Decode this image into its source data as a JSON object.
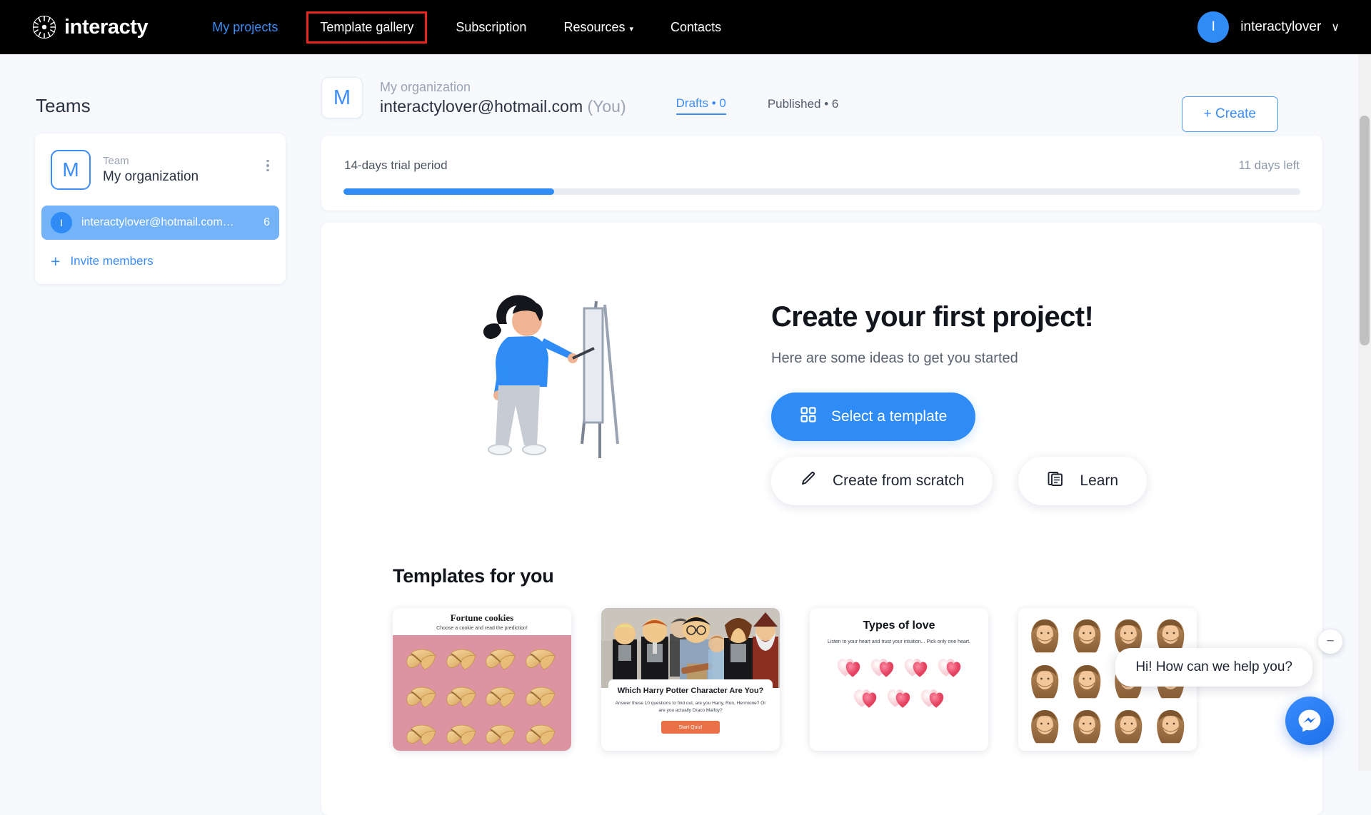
{
  "topnav": {
    "brand": "interacty",
    "brand_icon": "interacty-starburst-logo",
    "items": [
      {
        "label": "My projects",
        "state": "link"
      },
      {
        "label": "Template gallery",
        "state": "highlighted"
      },
      {
        "label": "Subscription",
        "state": "default"
      },
      {
        "label": "Resources",
        "state": "dropdown",
        "caret": "▾"
      },
      {
        "label": "Contacts",
        "state": "default"
      }
    ],
    "user": {
      "initial": "I",
      "name": "interactylover",
      "caret": "∨"
    },
    "highlight_color": "#e8251f",
    "link_color": "#3b8cf5"
  },
  "sidebar": {
    "title": "Teams",
    "team": {
      "badge": "M",
      "label": "Team",
      "name": "My organization",
      "menu_icon": "kebab-menu-icon"
    },
    "member": {
      "initial": "I",
      "email": "interactylover@hotmail.com…",
      "count": "6"
    },
    "invite": {
      "plus": "+",
      "label": "Invite members"
    }
  },
  "org_header": {
    "badge": "M",
    "subtitle": "My organization",
    "email": "interactylover@hotmail.com",
    "you": "(You)",
    "tabs": [
      {
        "label": "Drafts • 0",
        "active": true
      },
      {
        "label": "Published • 6",
        "active": false
      }
    ],
    "create_label": "+ Create"
  },
  "trial": {
    "label": "14-days trial period",
    "remaining": "11 days left",
    "percent": 22
  },
  "hero": {
    "title": "Create your first project!",
    "subtitle": "Here are some ideas to get you started",
    "primary_button": {
      "label": "Select a template",
      "icon": "grid-squares-icon"
    },
    "secondary_buttons": [
      {
        "label": "Create from scratch",
        "icon": "pencil-icon"
      },
      {
        "label": "Learn",
        "icon": "documents-icon"
      }
    ],
    "illustration": "woman-painting-at-easel-illustration"
  },
  "templates": {
    "heading": "Templates for you",
    "cards": [
      {
        "name": "fortune-cookies",
        "title": "Fortune cookies",
        "subtitle": "Choose a cookie and read the prediction!",
        "bg": "#dd94a2",
        "item_count": 12
      },
      {
        "name": "harry-potter-quiz",
        "title": "Which Harry Potter Character Are You?",
        "subtitle": "Answer these 10 questions to find out, are you Harry, Ron, Hermione? Or are you actually Draco Malfoy?",
        "button": "Start Quiz!",
        "button_color": "#ea7048"
      },
      {
        "name": "types-of-love",
        "title": "Types of love",
        "subtitle": "Listen to your heart and trust your intuition... Pick only one heart.",
        "item_count": 7
      },
      {
        "name": "hair-personality",
        "title": "",
        "subtitle": "",
        "item_count": 12
      }
    ]
  },
  "chat": {
    "greeting": "Hi! How can we help you?",
    "minimize_icon": "minimize-icon",
    "fab_icon": "messenger-icon"
  }
}
